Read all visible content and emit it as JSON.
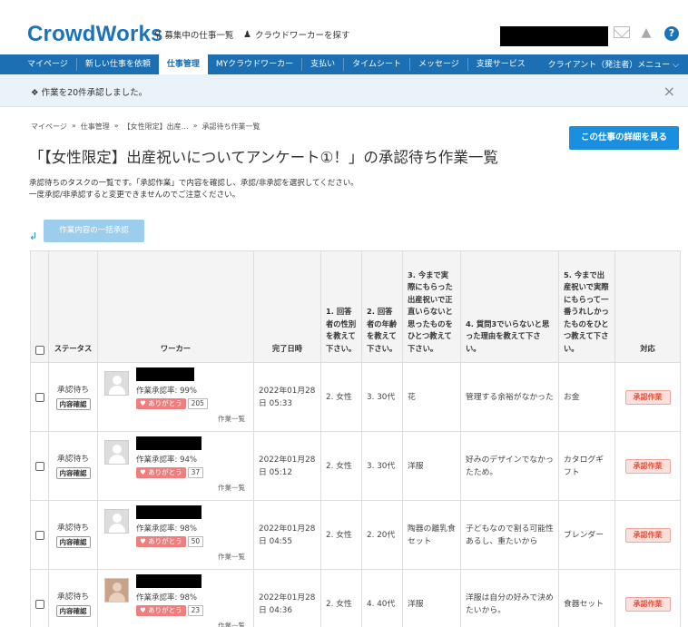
{
  "header": {
    "logo": "CrowdWorks",
    "search_jobs": "募集中の仕事一覧",
    "search_workers": "クラウドワーカーを探す"
  },
  "nav": {
    "items": [
      "マイページ",
      "新しい仕事を依頼",
      "仕事管理",
      "MYクラウドワーカー",
      "支払い",
      "タイムシート",
      "メッセージ",
      "支援サービス"
    ],
    "client_menu": "クライアント（発注者）メニュー"
  },
  "notice": {
    "text": "作業を20件承認しました。",
    "close": "×"
  },
  "breadcrumb": [
    "マイページ",
    "»",
    "仕事管理",
    "»",
    "【女性限定】出産…",
    "»",
    "承認待ち作業一覧"
  ],
  "detail_button": "この仕事の詳細を見る",
  "page_title": "「【女性限定】出産祝いについてアンケート①！」の承認待ち作業一覧",
  "description": {
    "line1": "承認待ちのタスクの一覧です。「承認作業」で内容を確認し、承認/非承認を選択してください。",
    "line2": "一度承認/非承認すると変更できませんのでご注意ください。"
  },
  "bulk_button": "作業内容の一括承認",
  "table": {
    "headers": {
      "status": "ステータス",
      "worker": "ワーカー",
      "completed": "完了日時",
      "q1": "1. 回答者の性別を教えて下さい。",
      "q2": "2. 回答者の年齢を教えて下さい。",
      "q3": "3. 今まで実際にもらった出産祝いで正直いらないと思ったものをひとつ教えて下さい。",
      "q4": "4. 質問3でいらないと思った理由を教えて下さい。",
      "q5": "5. 今まで出産祝いで実際にもらって一番うれしかったものをひとつ教えて下さい。",
      "action": "対応"
    },
    "rows": [
      {
        "status": "承認待ち",
        "content_button": "内容確認",
        "rate": "作業承認率: 99%",
        "thanks": "ありがとう",
        "thanks_count": "205",
        "worklist": "作業一覧",
        "date": "2022年01月28日 05:33",
        "q1": "2. 女性",
        "q2": "3. 30代",
        "q3": "花",
        "q4": "管理する余裕がなかった",
        "q5": "お金",
        "action": "承認作業"
      },
      {
        "status": "承認待ち",
        "content_button": "内容確認",
        "rate": "作業承認率: 94%",
        "thanks": "ありがとう",
        "thanks_count": "37",
        "worklist": "作業一覧",
        "date": "2022年01月28日 05:12",
        "q1": "2. 女性",
        "q2": "3. 30代",
        "q3": "洋服",
        "q4": "好みのデザインでなかったため。",
        "q5": "カタログギフト",
        "action": "承認作業"
      },
      {
        "status": "承認待ち",
        "content_button": "内容確認",
        "rate": "作業承認率: 98%",
        "thanks": "ありがとう",
        "thanks_count": "50",
        "worklist": "作業一覧",
        "date": "2022年01月28日 04:55",
        "q1": "2. 女性",
        "q2": "2. 20代",
        "q3": "陶器の離乳食セット",
        "q4": "子どもなので割る可能性あるし、重たいから",
        "q5": "ブレンダー",
        "action": "承認作業"
      },
      {
        "status": "承認待ち",
        "content_button": "内容確認",
        "rate": "作業承認率: 98%",
        "thanks": "ありがとう",
        "thanks_count": "23",
        "worklist": "作業一覧",
        "date": "2022年01月28日 04:36",
        "q1": "2. 女性",
        "q2": "4. 40代",
        "q3": "洋服",
        "q4": "洋服は自分の好みで決めたいから。",
        "q5": "食器セット",
        "action": "承認作業"
      }
    ]
  },
  "colors": {
    "brand": "#1d73b8",
    "nav": "#1b6fb2",
    "primary_button": "#1a8fe0",
    "approve": "#e3533f",
    "thanks": "#ef7f7f"
  }
}
